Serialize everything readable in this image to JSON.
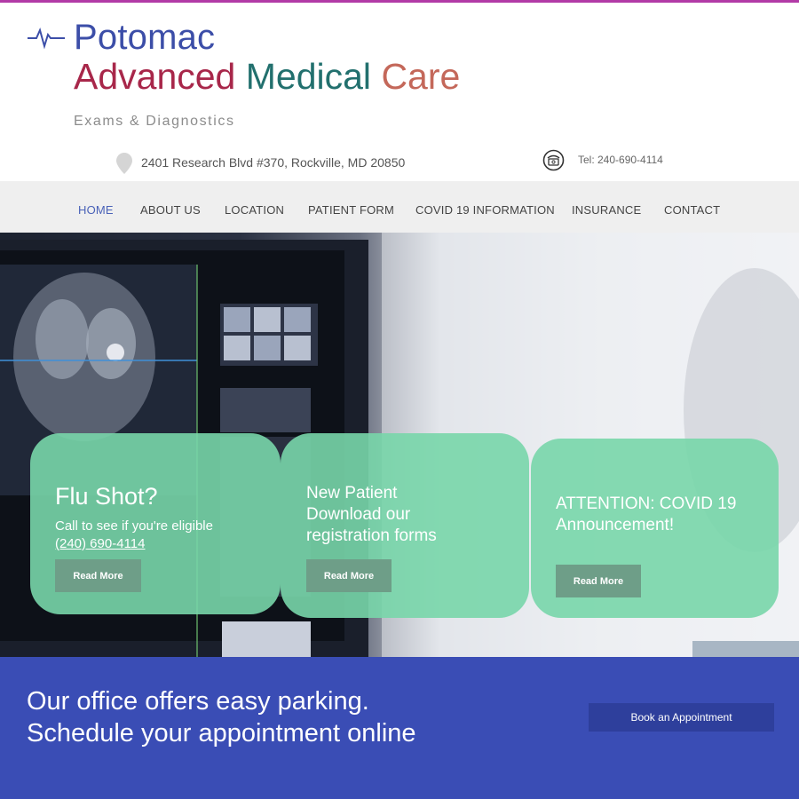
{
  "header": {
    "logo_line1": "Potomac",
    "logo_line2_part1": "Advanced",
    "logo_line2_part2": "Medical",
    "logo_line2_part3": "Care",
    "tagline": "Exams & Diagnostics",
    "logo_icon": "heartbeat-icon"
  },
  "contact": {
    "address": "2401 Research Blvd #370, Rockville, MD 20850",
    "address_icon": "map-pin-icon",
    "phone": "Tel: 240-690-4114",
    "phone_icon": "telephone-icon"
  },
  "nav": {
    "items": [
      {
        "label": "HOME",
        "active": true
      },
      {
        "label": "ABOUT US"
      },
      {
        "label": "LOCATION"
      },
      {
        "label": "PATIENT FORM"
      },
      {
        "label": "COVID 19 INFORMATION"
      },
      {
        "label": "INSURANCE"
      },
      {
        "label": "CONTACT"
      }
    ]
  },
  "cards": [
    {
      "title": "Flu Shot?",
      "text": "Call to see if you're eligible",
      "phone": "(240) 690-4114",
      "button": "Read More"
    },
    {
      "line1": "New Patient",
      "line2": "Download our",
      "line3": "registration forms",
      "button": "Read More"
    },
    {
      "line1": "ATTENTION: COVID 19",
      "line2": "Announcement!",
      "button": "Read More"
    }
  ],
  "banner": {
    "line1": "Our office offers easy parking.",
    "line2": "Schedule your appointment online",
    "button": "Book an Appointment"
  },
  "colors": {
    "accent_blue": "#3c4ea8",
    "banner_blue": "#3a4db5",
    "card_green": "#78d6aa",
    "top_rule": "#b23aa6"
  }
}
